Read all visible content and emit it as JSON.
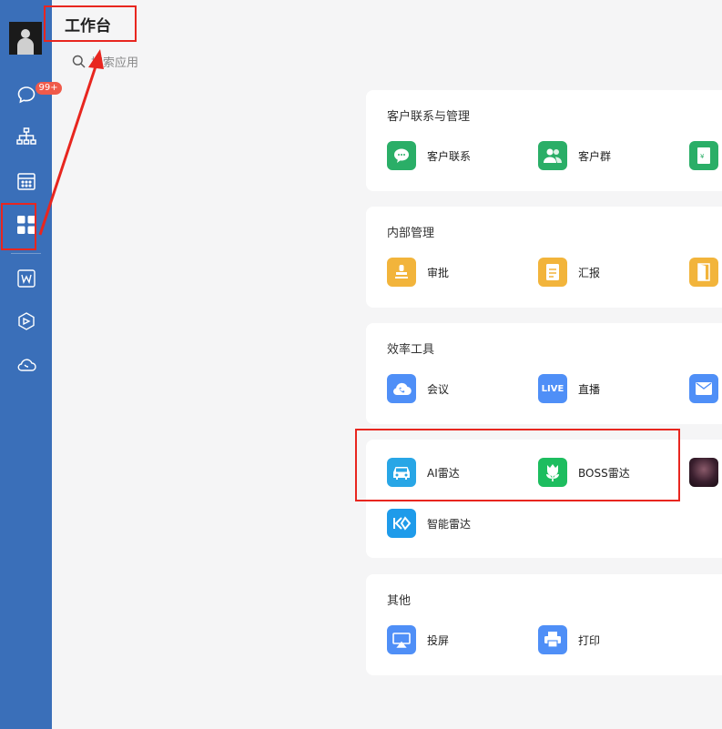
{
  "header": {
    "title": "工作台"
  },
  "search": {
    "placeholder": "搜索应用"
  },
  "sidebar": {
    "badge": "99+"
  },
  "sections": [
    {
      "title": "客户联系与管理",
      "apps": [
        {
          "label": "客户联系",
          "icon": "wechat-chat-icon",
          "color": "#2aae67"
        },
        {
          "label": "客户群",
          "icon": "customer-group-icon",
          "color": "#2aae67"
        },
        {
          "label": "",
          "icon": "green-doc-icon",
          "color": "#2aae67"
        }
      ]
    },
    {
      "title": "内部管理",
      "apps": [
        {
          "label": "审批",
          "icon": "stamp-icon",
          "color": "#f2b43b"
        },
        {
          "label": "汇报",
          "icon": "report-icon",
          "color": "#f2b43b"
        },
        {
          "label": "",
          "icon": "door-icon",
          "color": "#f2b43b"
        }
      ]
    },
    {
      "title": "效率工具",
      "apps": [
        {
          "label": "会议",
          "icon": "phone-cloud-icon",
          "color": "#4f8ff7"
        },
        {
          "label": "直播",
          "icon": "live-icon",
          "color": "#4f8ff7"
        },
        {
          "label": "",
          "icon": "mail-icon",
          "color": "#4f8ff7"
        }
      ]
    },
    {
      "title": "",
      "apps": [
        {
          "label": "AI雷达",
          "icon": "car-icon",
          "color": "#28a6e6"
        },
        {
          "label": "BOSS雷达",
          "icon": "tulip-icon",
          "color": "#1dbd5f"
        },
        {
          "label": "",
          "icon": "photo-thumbnail",
          "color": "#2a1a2a"
        },
        {
          "label": "智能雷达",
          "icon": "kk-logo-icon",
          "color": "#1e9bea"
        }
      ]
    },
    {
      "title": "其他",
      "apps": [
        {
          "label": "投屏",
          "icon": "screen-cast-icon",
          "color": "#4f8ff7"
        },
        {
          "label": "打印",
          "icon": "printer-icon",
          "color": "#4f8ff7"
        }
      ]
    }
  ]
}
